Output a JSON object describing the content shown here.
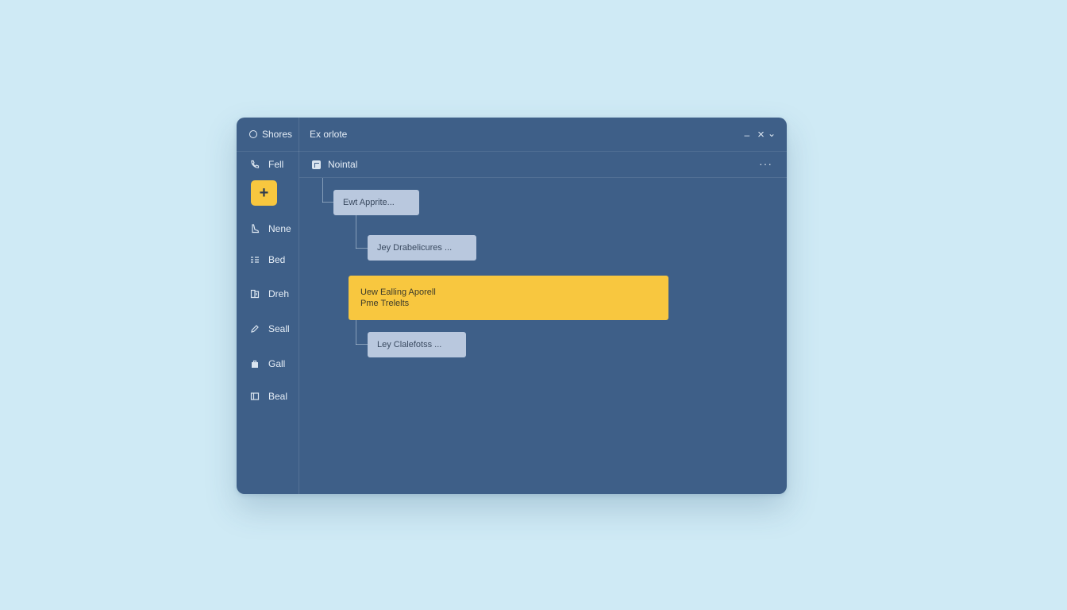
{
  "sidebar": {
    "header": "Shores",
    "items": [
      {
        "label": "Fell",
        "icon": "phone-icon"
      },
      {
        "label": "Nene",
        "icon": "boot-icon"
      },
      {
        "label": "Bed",
        "icon": "list-icon"
      },
      {
        "label": "Dreh",
        "icon": "file-icon"
      },
      {
        "label": "Seall",
        "icon": "pen-icon"
      },
      {
        "label": "Gall",
        "icon": "bag-icon"
      },
      {
        "label": "Beal",
        "icon": "panel-icon"
      }
    ],
    "add_label": "+"
  },
  "window": {
    "title": "Ex orlote",
    "minimize": "–",
    "close": "×",
    "dropdown": "⌄"
  },
  "toolbar": {
    "label": "Nointal",
    "more": "···"
  },
  "tree": {
    "node1": "Ewt Apprite...",
    "node2": "Jey Drabelicures ...",
    "highlight_line1": "Uew Ealling Aporell",
    "highlight_line2": "Pme Trelelts",
    "node3": "Ley Clalefotss ..."
  },
  "colors": {
    "window_bg": "#3e5f88",
    "accent": "#f8c73f",
    "node_bg": "#b9c8de",
    "page_bg": "#cfeaf5"
  }
}
